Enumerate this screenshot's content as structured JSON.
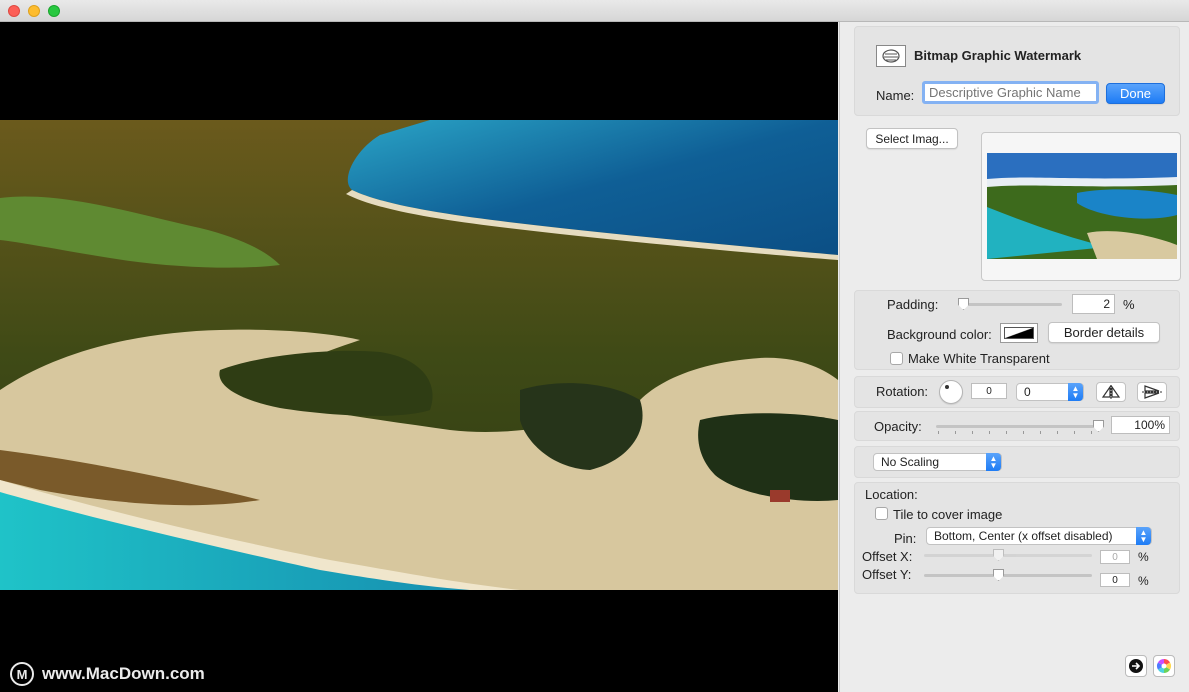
{
  "header": {
    "title": "Bitmap Graphic Watermark",
    "icon": "watermark-graphic-icon"
  },
  "name_row": {
    "label": "Name:",
    "value": "",
    "placeholder": "Descriptive Graphic Name",
    "done_label": "Done"
  },
  "image": {
    "select_label": "Select Imag..."
  },
  "padding": {
    "label": "Padding:",
    "value": "2",
    "unit": "%",
    "slider_fraction": 0.02
  },
  "background": {
    "label": "Background color:",
    "border_label": "Border details"
  },
  "transparent": {
    "label": "Make White Transparent",
    "checked": false
  },
  "rotation": {
    "label": "Rotation:",
    "field_value": "0",
    "popup_value": "0",
    "flip_h_icon": "flip-horizontal-icon",
    "flip_v_icon": "flip-vertical-icon"
  },
  "opacity": {
    "label": "Opacity:",
    "value": "100%",
    "slider_fraction": 1.0
  },
  "scaling": {
    "selected": "No Scaling"
  },
  "location": {
    "label": "Location:",
    "tile_label": "Tile to cover image",
    "tile_checked": false,
    "pin_label": "Pin:",
    "pin_value": "Bottom, Center (x offset disabled)",
    "offset_x_label": "Offset X:",
    "offset_x_value": "0",
    "offset_x_fraction": 0.5,
    "offset_y_label": "Offset Y:",
    "offset_y_value": "0",
    "offset_y_fraction": 0.5,
    "unit": "%"
  },
  "footer": {
    "next_icon": "arrow-right-icon",
    "color_icon": "color-wheel-icon"
  },
  "watermark_text": "www.MacDown.com",
  "colors": {
    "accent": "#1e7cf5",
    "canvas_bg": "#000000",
    "panel_bg": "#ececec"
  }
}
